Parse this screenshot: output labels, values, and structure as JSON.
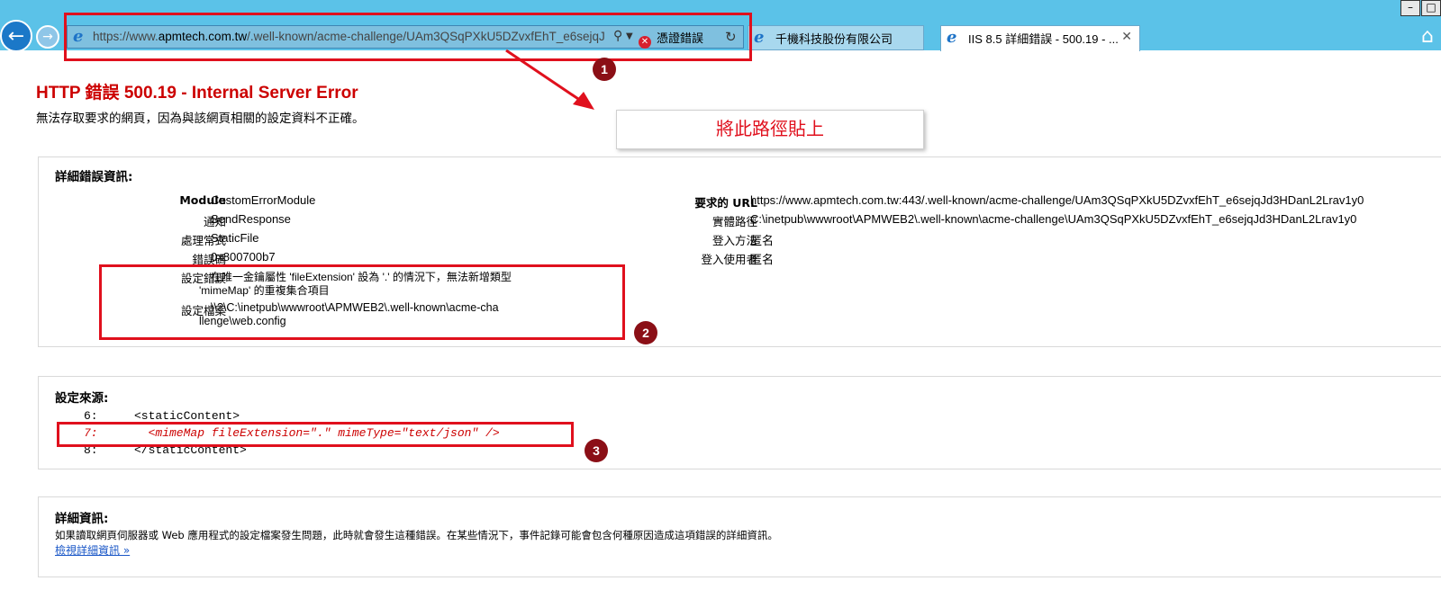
{
  "browser": {
    "url_prefix": "https://www.",
    "url_domain": "apmtech.com.tw",
    "url_rest": "/.well-known/acme-challenge/UAm3QSqPXkU5DZvxfEhT_e6sejqJ",
    "cert_error": "憑證錯誤",
    "tabs": [
      {
        "title": "千機科技股份有限公司"
      },
      {
        "title": "IIS 8.5 詳細錯誤 - 500.19 - ..."
      }
    ]
  },
  "annotations": {
    "badge1": "1",
    "badge2": "2",
    "badge3": "3",
    "callout": "將此路徑貼上"
  },
  "error": {
    "title": "HTTP 錯誤 500.19 - Internal Server Error",
    "subtitle": "無法存取要求的網頁，因為與該網頁相關的設定資料不正確。"
  },
  "detail": {
    "heading": "詳細錯誤資訊:",
    "left": [
      {
        "label": "Module",
        "value": "CustomErrorModule"
      },
      {
        "label": "通知",
        "value": "SendResponse"
      },
      {
        "label": "處理常式",
        "value": "StaticFile"
      },
      {
        "label": "錯誤碼",
        "value": "0x800700b7"
      }
    ],
    "config_error_label": "設定錯誤",
    "config_error_line1": "在唯一金鑰屬性 'fileExtension' 設為 '.' 的情況下，無法新增類型",
    "config_error_line2": "'mimeMap' 的重複集合項目",
    "config_file_label": "設定檔案",
    "config_file_line1": "\\\\?\\C:\\inetpub\\wwwroot\\APMWEB2\\.well-known\\acme-cha",
    "config_file_line2": "llenge\\web.config",
    "right": [
      {
        "label": "要求的 URL",
        "value": "https://www.apmtech.com.tw:443/.well-known/acme-challenge/UAm3QSqPXkU5DZvxfEhT_e6sejqJd3HDanL2Lrav1y0"
      },
      {
        "label": "實體路徑",
        "value": "C:\\inetpub\\wwwroot\\APMWEB2\\.well-known\\acme-challenge\\UAm3QSqPXkU5DZvxfEhT_e6sejqJd3HDanL2Lrav1y0"
      },
      {
        "label": "登入方法",
        "value": "匿名"
      },
      {
        "label": "登入使用者",
        "value": "匿名"
      }
    ]
  },
  "source": {
    "heading": "設定來源:",
    "lines": [
      {
        "num": "6:",
        "code": "<staticContent>"
      },
      {
        "num": "7:",
        "code": "  <mimeMap fileExtension=\".\" mimeType=\"text/json\" />"
      },
      {
        "num": "8:",
        "code": "</staticContent>"
      }
    ]
  },
  "more": {
    "heading": "詳細資訊:",
    "text": "如果讀取網頁伺服器或 Web 應用程式的設定檔案發生問題，此時就會發生這種錯誤。在某些情況下，事件記錄可能會包含何種原因造成這項錯誤的詳細資訊。",
    "link": "檢視詳細資訊 »"
  }
}
